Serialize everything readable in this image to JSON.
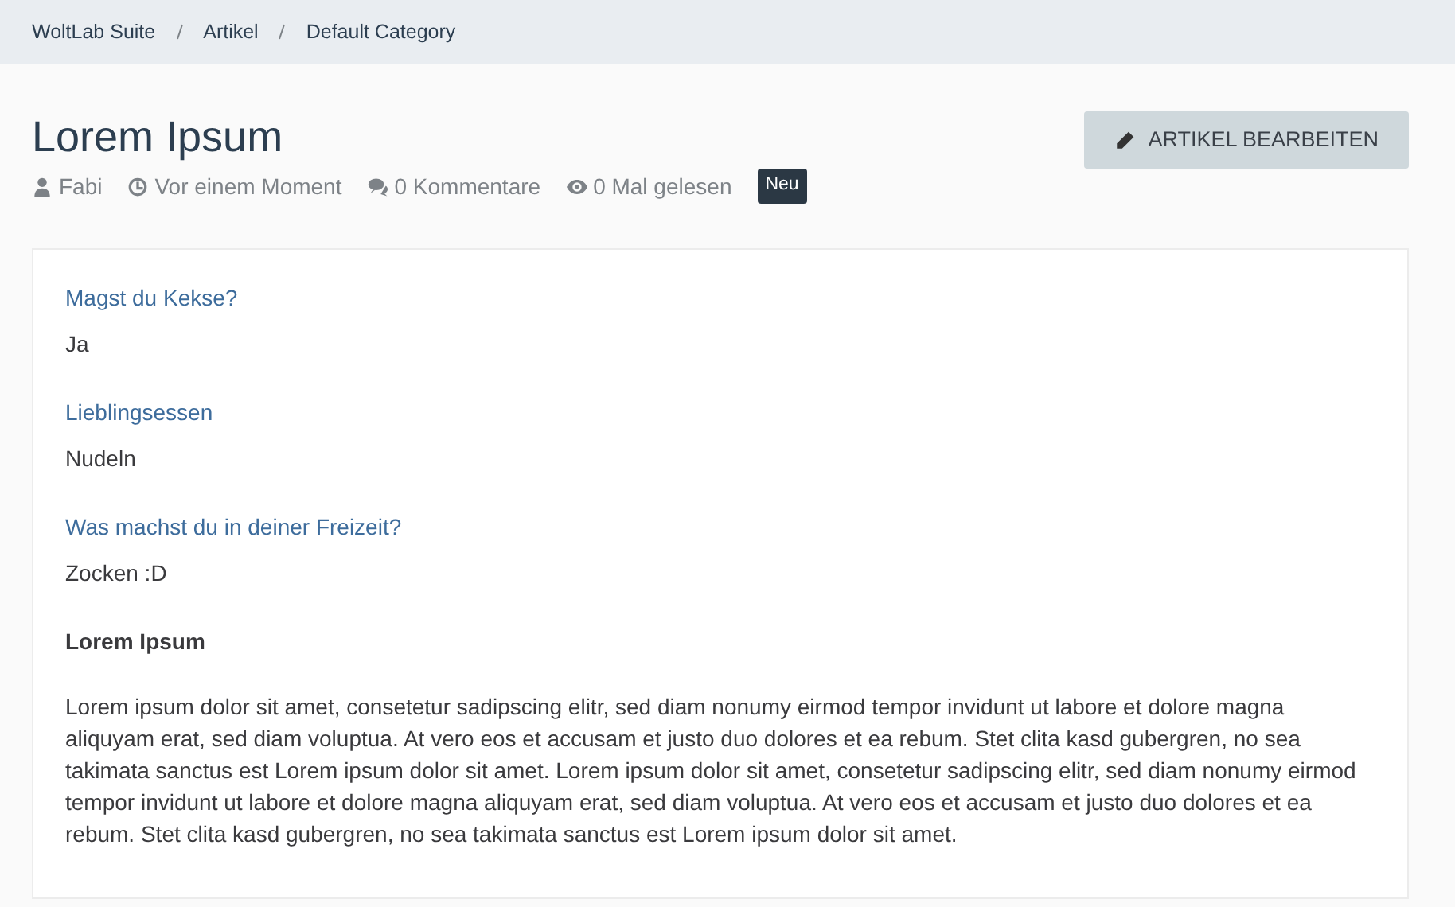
{
  "breadcrumbs": [
    "WoltLab Suite",
    "Artikel",
    "Default Category"
  ],
  "title": "Lorem Ipsum",
  "meta": [
    {
      "kind": "user",
      "text": "Fabi"
    },
    {
      "kind": "clock",
      "text": "Vor einem Moment"
    },
    {
      "kind": "comments",
      "text": "0 Kommentare"
    },
    {
      "kind": "eye",
      "text": "0 Mal gelesen"
    }
  ],
  "badge": "Neu",
  "edit_button": "ARTIKEL BEARBEITEN",
  "fields": [
    {
      "label": "Magst du Kekse?",
      "value": "Ja"
    },
    {
      "label": "Lieblingsessen",
      "value": "Nudeln"
    },
    {
      "label": "Was machst du in deiner Freizeit?",
      "value": "Zocken :D"
    }
  ],
  "content_heading": "Lorem Ipsum",
  "content_text": "Lorem ipsum dolor sit amet, consetetur sadipscing elitr, sed diam nonumy eirmod tempor invidunt ut labore et dolore magna aliquyam erat, sed diam voluptua. At vero eos et accusam et justo duo dolores et ea rebum. Stet clita kasd gubergren, no sea takimata sanctus est Lorem ipsum dolor sit amet. Lorem ipsum dolor sit amet, consetetur sadipscing elitr, sed diam nonumy eirmod tempor invidunt ut labore et dolore magna aliquyam erat, sed diam voluptua. At vero eos et accusam et justo duo dolores et ea rebum. Stet clita kasd gubergren, no sea takimata sanctus est Lorem ipsum dolor sit amet."
}
